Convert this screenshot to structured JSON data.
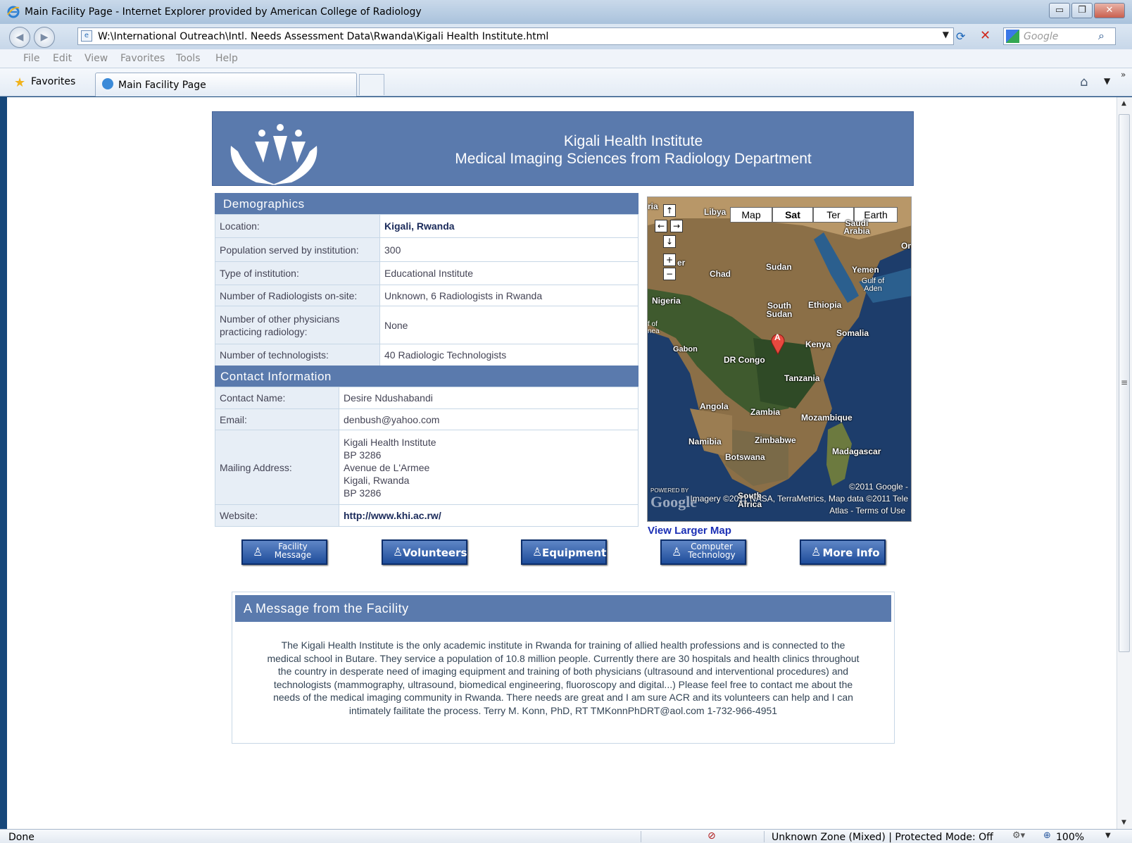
{
  "window": {
    "title": "Main Facility Page - Internet Explorer provided by American College of Radiology",
    "url": "W:\\International Outreach\\Intl. Needs Assessment Data\\Rwanda\\Kigali Health Institute.html",
    "search_placeholder": "Google",
    "menu": [
      "File",
      "Edit",
      "View",
      "Favorites",
      "Tools",
      "Help"
    ],
    "favorites_label": "Favorites",
    "tab_label": "Main Facility Page"
  },
  "status": {
    "left": "Done",
    "zone": "Unknown Zone (Mixed) | Protected Mode: Off",
    "zoom": "100%"
  },
  "banner": {
    "line1": "Kigali Health Institute",
    "line2": "Medical Imaging Sciences from Radiology Department"
  },
  "demographics": {
    "header": "Demographics",
    "rows": [
      {
        "label": "Location:",
        "value": "Kigali, Rwanda"
      },
      {
        "label": "Population served by institution:",
        "value": "300"
      },
      {
        "label": "Type of institution:",
        "value": "Educational Institute"
      },
      {
        "label": "Number of Radiologists on-site:",
        "value": "Unknown, 6 Radiologists in Rwanda"
      },
      {
        "label": "Number of other physicians practicing radiology:",
        "value": "None"
      },
      {
        "label": "Number of technologists:",
        "value": "40 Radiologic Technologists"
      }
    ]
  },
  "contact": {
    "header": "Contact Information",
    "name_label": "Contact Name:",
    "name": "Desire Ndushabandi",
    "email_label": "Email:",
    "email": "denbush@yahoo.com",
    "address_label": "Mailing Address:",
    "address": [
      "Kigali Health Institute",
      "BP 3286",
      "Avenue de L'Armee",
      "Kigali, Rwanda",
      "BP 3286"
    ],
    "website_label": "Website:",
    "website": "http://www.khi.ac.rw/"
  },
  "map": {
    "types": [
      "Map",
      "Sat",
      "Ter",
      "Earth"
    ],
    "selected_type": "Sat",
    "marker": "A",
    "labels": [
      "Libya",
      "Saudi Arabia",
      "Om",
      "Sudan",
      "Chad",
      "Yemen",
      "Gulf of Aden",
      "Nigeria",
      "Ethiopia",
      "South Sudan",
      "Somalia",
      "Kenya",
      "Gabon",
      "DR Congo",
      "Tanzania",
      "Angola",
      "Zambia",
      "Mozambique",
      "Namibia",
      "Zimbabwe",
      "Madagascar",
      "Botswana",
      "South Africa",
      "ria",
      "er",
      "f of nea"
    ],
    "copyright1": "©2011 Google -",
    "copyright2": "Imagery ©2011 NASA, TerraMetrics, Map data ©2011 Tele",
    "copyright3": "Atlas - Terms of Use",
    "powered": "POWERED BY",
    "google": "Google",
    "larger_link": "View Larger Map"
  },
  "buttons": [
    {
      "line1": "Facility",
      "line2": "Message"
    },
    {
      "label": "Volunteers"
    },
    {
      "label": "Equipment"
    },
    {
      "line1": "Computer",
      "line2": "Technology"
    },
    {
      "label": "More Info"
    }
  ],
  "message": {
    "header": "A Message from the Facility",
    "lines": [
      "The Kigali Health Institute is the only academic institute in Rwanda for training of allied health professions and is connected to the",
      "medical school in Butare. They service a population of 10.8 million people. Currently there are 30 hospitals and health clinics throughout",
      "the country in desperate need of imaging equipment and training of both physicians (ultrasound and interventional procedures) and",
      "technologists (mammography, ultrasound, biomedical engineering, fluoroscopy and digital...) Please feel free to contact me about the",
      "needs of the medical imaging community in Rwanda. There needs are great and I am sure ACR and its volunteers can help and I can",
      "intimately failitate the process. Terry M. Konn, PhD, RT TMKonnPhDRT@aol.com 1-732-966-4951"
    ]
  },
  "colors": {
    "header_blue": "#5a7aad",
    "label_bg": "#e7eef6",
    "link_blue": "#1b2fb5"
  }
}
